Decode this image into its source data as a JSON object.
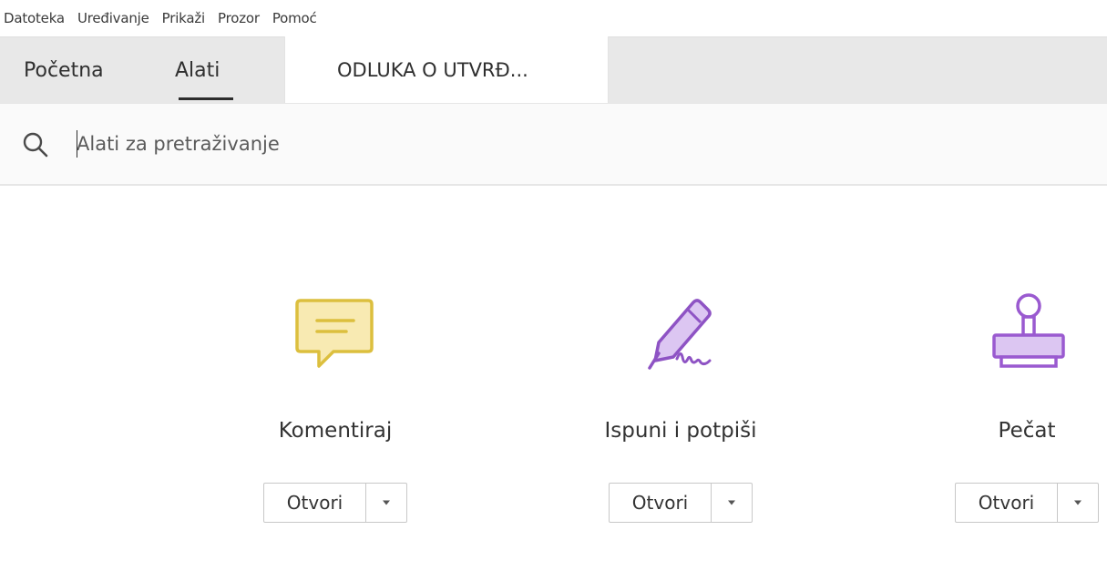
{
  "menubar": {
    "items": [
      "Datoteka",
      "Uređivanje",
      "Prikaži",
      "Prozor",
      "Pomoć"
    ]
  },
  "tabs": {
    "home": "Početna",
    "tools": "Alati",
    "document": "ODLUKA O UTVRĐ..."
  },
  "search": {
    "placeholder": "Alati za pretraživanje",
    "value": ""
  },
  "tools": [
    {
      "name": "Komentiraj",
      "open_label": "Otvori",
      "icon": "comment-icon",
      "color": "#e0c64a"
    },
    {
      "name": "Ispuni i potpiši",
      "open_label": "Otvori",
      "icon": "fill-sign-icon",
      "color": "#8e53c4"
    },
    {
      "name": "Pečat",
      "open_label": "Otvori",
      "icon": "stamp-icon",
      "color": "#9a5ad0"
    }
  ]
}
